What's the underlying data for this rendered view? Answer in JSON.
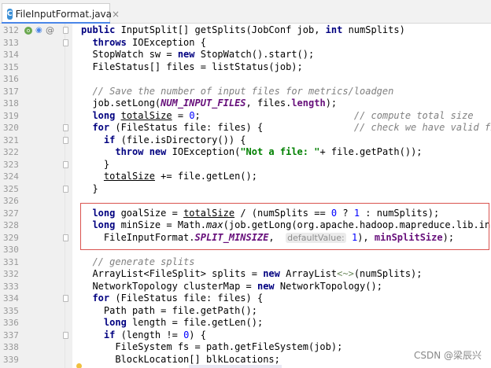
{
  "tab": {
    "label": "FileInputFormat.java",
    "icon": "java-class-icon",
    "close": "×"
  },
  "lines": [
    {
      "n": "312",
      "html": "<span class=\"kw\">public</span> InputSplit[] getSplits(JobConf job, <span class=\"kw\">int</span> numSplits)"
    },
    {
      "n": "313",
      "html": "  <span class=\"kw\">throws</span> IOException {"
    },
    {
      "n": "314",
      "html": "  StopWatch sw = <span class=\"kw\">new</span> StopWatch().start();"
    },
    {
      "n": "315",
      "html": "  FileStatus[] files = listStatus(job);"
    },
    {
      "n": "316",
      "html": ""
    },
    {
      "n": "317",
      "html": "  <span class=\"cm\">// Save the number of input files for metrics/loadgen</span>"
    },
    {
      "n": "318",
      "html": "  job.setLong(<span class=\"cst\">NUM_INPUT_FILES</span>, files.<span class=\"fld\">length</span>);"
    },
    {
      "n": "319",
      "html": "  <span class=\"kw\">long</span> <span class=\"ul\">totalSize</span> = <span class=\"num\">0</span>;                           <span class=\"cm\">// compute total size</span>"
    },
    {
      "n": "320",
      "html": "  <span class=\"kw\">for</span> (FileStatus file: files) {                <span class=\"cm\">// check we have valid files</span>"
    },
    {
      "n": "321",
      "html": "    <span class=\"kw\">if</span> (file.isDirectory()) {"
    },
    {
      "n": "322",
      "html": "      <span class=\"kw\">throw new</span> IOException(<span class=\"str\">\"Not a file: \"</span>+ file.getPath());"
    },
    {
      "n": "323",
      "html": "    }"
    },
    {
      "n": "324",
      "html": "    <span class=\"ul\">totalSize</span> += file.getLen();"
    },
    {
      "n": "325",
      "html": "  }"
    },
    {
      "n": "326",
      "html": ""
    },
    {
      "n": "327",
      "html": "  <span class=\"kw\">long</span> goalSize = <span class=\"ul\">totalSize</span> / (numSplits == <span class=\"num\">0</span> ? <span class=\"num\">1</span> : numSplits);"
    },
    {
      "n": "328",
      "html": "  <span class=\"kw\">long</span> minSize = Math.<span class=\"ital\">max</span>(job.getLong(org.apache.hadoop.mapreduce.lib.input."
    },
    {
      "n": "329",
      "html": "    FileInputFormat.<span class=\"cst\">SPLIT_MINSIZE</span>,  <span class=\"hint\">defaultValue:</span> <span class=\"num\">1</span>), <span class=\"fld\">minSplitSize</span>);"
    },
    {
      "n": "330",
      "html": ""
    },
    {
      "n": "331",
      "html": "  <span class=\"cm\">// generate splits</span>"
    },
    {
      "n": "332",
      "html": "  ArrayList&lt;FileSplit&gt; splits = <span class=\"kw\">new</span> ArrayList<span class=\"diamond\">&lt;~&gt;</span>(numSplits);"
    },
    {
      "n": "333",
      "html": "  NetworkTopology clusterMap = <span class=\"kw\">new</span> NetworkTopology();"
    },
    {
      "n": "334",
      "html": "  <span class=\"kw\">for</span> (FileStatus file: files) {"
    },
    {
      "n": "335",
      "html": "    Path path = file.getPath();"
    },
    {
      "n": "336",
      "html": "    <span class=\"kw\">long</span> length = file.getLen();"
    },
    {
      "n": "337",
      "html": "    <span class=\"kw\">if</span> (length != <span class=\"num\">0</span>) {"
    },
    {
      "n": "338",
      "html": "      FileSystem fs = path.getFileSystem(job);"
    },
    {
      "n": "339",
      "html": "      BlockLocation[] blkLocations;"
    }
  ],
  "fold_markers_at": [
    "312",
    "313",
    "320",
    "321",
    "323",
    "325",
    "329",
    "334",
    "337"
  ],
  "watermark": "CSDN @梁辰兴"
}
